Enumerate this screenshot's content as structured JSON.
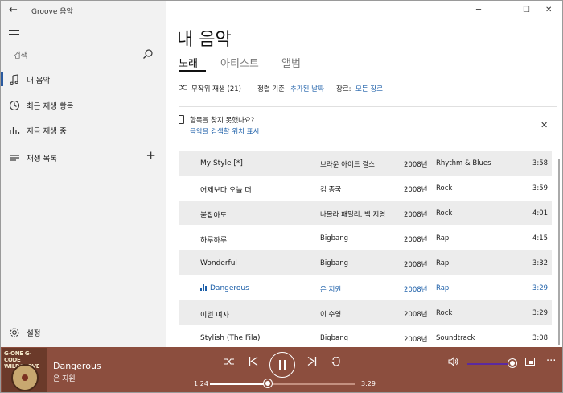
{
  "app": {
    "title": "Groove 음악"
  },
  "search": {
    "placeholder": "검색"
  },
  "sidebar": {
    "items": [
      {
        "label": "내 음악"
      },
      {
        "label": "최근 재생 항목"
      },
      {
        "label": "지금 재생 중"
      },
      {
        "label": "재생 목록"
      }
    ],
    "settings_label": "설정"
  },
  "main": {
    "title": "내 음악",
    "tabs": [
      {
        "label": "노래"
      },
      {
        "label": "아티스트"
      },
      {
        "label": "앨범"
      }
    ],
    "filters": {
      "shuffle_label": "무작위 재생 (21)",
      "sort_prefix": "정렬 기준:",
      "sort_value": "추가된 날짜",
      "genre_prefix": "장르:",
      "genre_value": "모든 장르"
    },
    "notice": {
      "question": "항목을 찾지 못했나요?",
      "link": "음악을 검색할 위치 표시"
    }
  },
  "songs": [
    {
      "title": "My Style [*]",
      "artist": "브라운 아이드 걸스",
      "year": "2008년",
      "genre": "Rhythm & Blues",
      "duration": "3:58"
    },
    {
      "title": "어제보다 오늘 더",
      "artist": "김 종국",
      "year": "2008년",
      "genre": "Rock",
      "duration": "3:59"
    },
    {
      "title": "붙잡아도",
      "artist": "나몰라 패밀리, 백 지영",
      "year": "2008년",
      "genre": "Rock",
      "duration": "4:01"
    },
    {
      "title": "하루하루",
      "artist": "Bigbang",
      "year": "2008년",
      "genre": "Rap",
      "duration": "4:15"
    },
    {
      "title": "Wonderful",
      "artist": "Bigbang",
      "year": "2008년",
      "genre": "Rap",
      "duration": "3:32"
    },
    {
      "title": "Dangerous",
      "artist": "은 지원",
      "year": "2008년",
      "genre": "Rap",
      "duration": "3:29"
    },
    {
      "title": "이런 여자",
      "artist": "이 수영",
      "year": "2008년",
      "genre": "Rock",
      "duration": "3:29"
    },
    {
      "title": "Stylish (The Fila)",
      "artist": "Bigbang",
      "year": "2008년",
      "genre": "Soundtrack",
      "duration": "3:08"
    }
  ],
  "now_playing": {
    "title": "Dangerous",
    "artist": "은 지원",
    "elapsed": "1:24",
    "total": "3:29",
    "progress_fraction": 0.4,
    "volume_fraction": 1.0,
    "album_art_text": "G-ONE G-CODE WILD&LOVE"
  },
  "colors": {
    "accent": "#1b5ea8",
    "player_bg": "#8c4e3e",
    "volume_fill": "#5b2aa0"
  }
}
